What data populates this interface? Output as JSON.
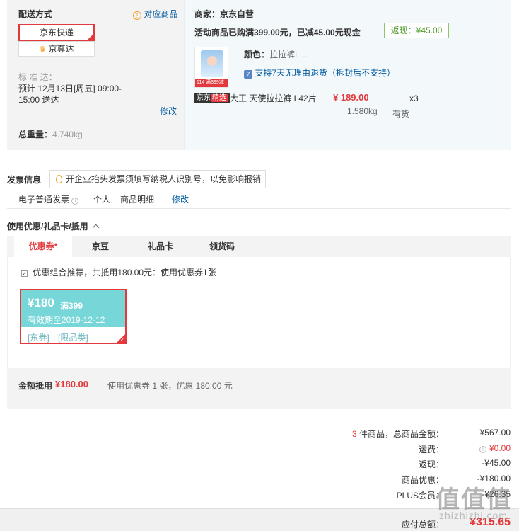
{
  "shipping": {
    "title": "配送方式",
    "match_link": "对应商品",
    "express_label": "京东快递",
    "zunda_label": "京尊达",
    "std_label": "标 准 达：",
    "std_line1": "预计 12月13日[周五] 09:00-",
    "std_line2": "15:00 送达",
    "edit_link": "修改",
    "weight_label": "总重量：",
    "weight_value": "4.740kg"
  },
  "merchant": {
    "label": "商家：京东自营",
    "promo": "活动商品已购满399.00元，已减45.00元现金",
    "rebate": "返现：¥45.00",
    "color_label": "颜色：",
    "color_value": "拉拉裤L...",
    "return_policy": "支持7天无理由退货（拆封后不支持）",
    "jd_tag": "京东",
    "jd_tag_b": "精选",
    "product_name": "大王 天使拉拉裤 L42片",
    "price": "¥ 189.00",
    "qty": "x3",
    "item_weight": "1.580kg",
    "stock": "有货",
    "thumb_strip": "114 满399减45"
  },
  "invoice": {
    "title": "发票信息",
    "hint": "开企业抬头发票须填写纳税人识别号，以免影响报销",
    "type": "电子普通发票",
    "personal": "个人",
    "detail": "商品明细",
    "edit": "修改"
  },
  "coupon": {
    "section_title": "使用优惠/礼品卡/抵用",
    "tabs": [
      "优惠券",
      "京豆",
      "礼品卡",
      "领货码"
    ],
    "recommend": "优惠组合推荐，共抵用180.00元：使用优惠券1张",
    "amount": "¥180",
    "threshold": "满399",
    "expiry": "有效期至2019-12-12",
    "tag1": "[东券]",
    "tag2": "[限品类]",
    "deduct_label": "金额抵用",
    "deduct_value": "¥180.00",
    "deduct_desc": "使用优惠券 1 张，优惠 180.00 元"
  },
  "summary": {
    "count": "3",
    "count_suffix": "件商品，总商品金额：",
    "total": "¥567.00",
    "shipping_label": "运费：",
    "shipping_value": "¥0.00",
    "rebate_label": "返现：",
    "rebate_value": "-¥45.00",
    "coupon_label": "商品优惠：",
    "coupon_value": "-¥180.00",
    "plus_label": "PLUS会员：",
    "plus_value": "-¥26.35",
    "payable_label": "应付总额：",
    "payable_value": "¥315.65"
  },
  "watermark": {
    "main": "值值值",
    "sub": "zhizhizhi.com"
  },
  "colors": {
    "accent_red": "#e4393c",
    "link_blue": "#005aa0",
    "rebate_green": "#4f9a2c",
    "coupon_teal": "#76d6d8"
  }
}
